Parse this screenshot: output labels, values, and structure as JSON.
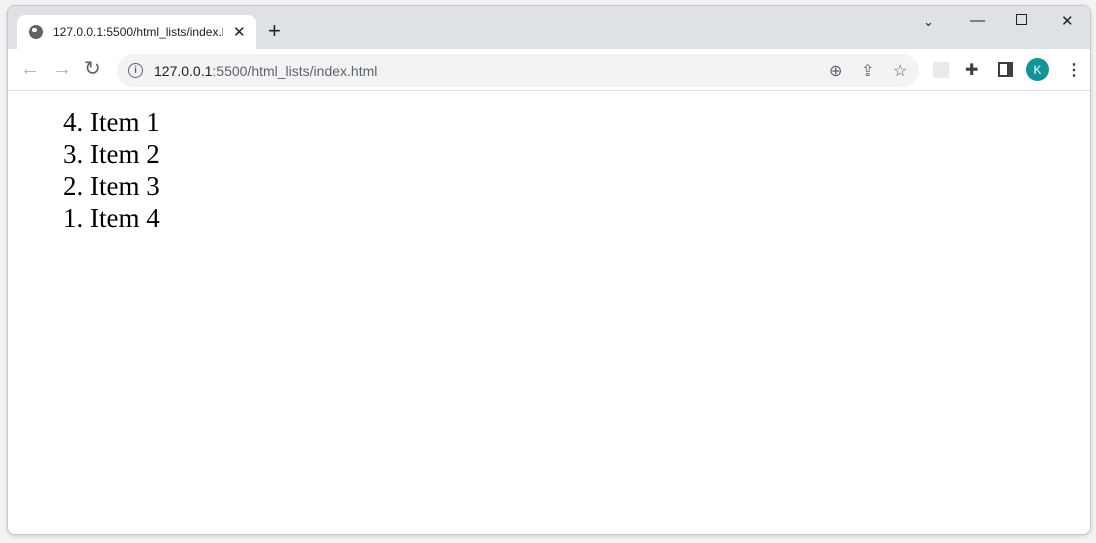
{
  "tab": {
    "title": "127.0.0.1:5500/html_lists/index.h",
    "icon": "globe-icon"
  },
  "address": {
    "host": "127.0.0.1",
    "rest": ":5500/html_lists/index.html"
  },
  "avatar": {
    "initial": "K",
    "color": "#12939a"
  },
  "list": {
    "reversed": true,
    "items": [
      {
        "num": "4.",
        "label": "Item 1"
      },
      {
        "num": "3.",
        "label": "Item 2"
      },
      {
        "num": "2.",
        "label": "Item 3"
      },
      {
        "num": "1.",
        "label": "Item 4"
      }
    ]
  }
}
